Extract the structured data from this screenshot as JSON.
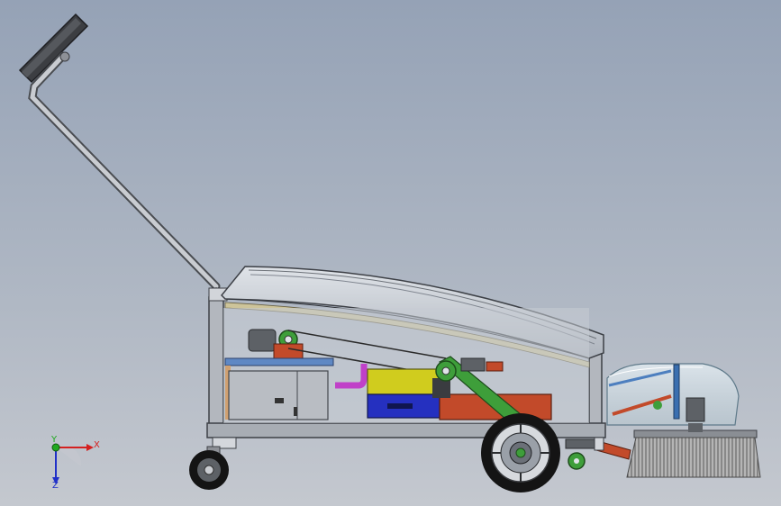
{
  "viewport": {
    "background_top": "#95a2b6",
    "background_bottom": "#c4c8cf"
  },
  "triad": {
    "x_label": "X",
    "y_label": "Y",
    "z_label": "Z",
    "x_color": "#d42020",
    "y_color": "#1fa81f",
    "z_color": "#2030c8"
  },
  "colors": {
    "frame": "#9a9ea6",
    "frame_dark": "#4a4e55",
    "hood": "#c3c8cf",
    "tank_yellow": "#d0cc1e",
    "tank_blue": "#2530c0",
    "motor_red": "#c24a2a",
    "belt_green": "#3e9e3a",
    "hose_magenta": "#c040c8",
    "brush_bristle": "#8c8c8c",
    "tire": "#141414"
  }
}
